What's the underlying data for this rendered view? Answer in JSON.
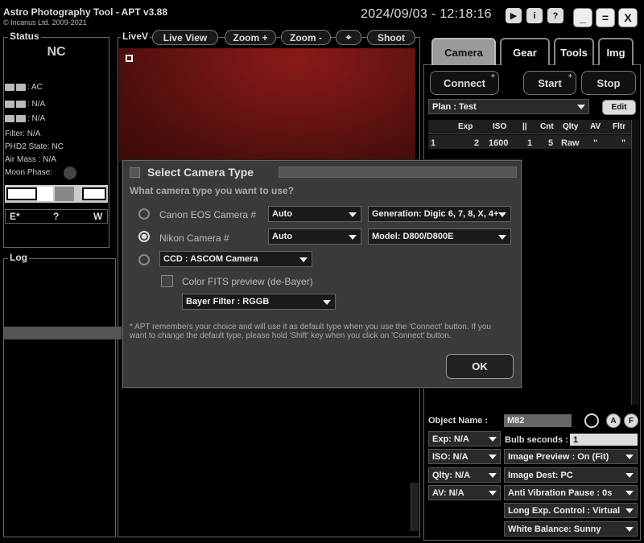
{
  "app": {
    "title": "Astro Photography Tool  -  APT v3.88",
    "copyright": "© Incanus Ltd. 2009-2021",
    "datetime": "2024/09/03 - 12:18:16"
  },
  "title_icons": {
    "play": "▶",
    "info": "i",
    "help": "?"
  },
  "window_buttons": {
    "minimize": "_",
    "maximize": "=",
    "close": "X"
  },
  "status": {
    "title": "Status",
    "connection": "NC",
    "power": ": AC",
    "camera_battery": ": N/A",
    "device_storage": ": N/A",
    "filter": "Filter: N/A",
    "phd2": "PHD2 State: NC",
    "air_mass": "Air Mass : N/A",
    "moon_phase": "Moon Phase:",
    "compass": {
      "e": "E*",
      "q": "?",
      "w": "W"
    }
  },
  "livev": {
    "title": "LiveV",
    "buttons": [
      "Live View",
      "Zoom +",
      "Zoom -",
      "⌖",
      "Shoot"
    ]
  },
  "log": {
    "title": "Log"
  },
  "tabs": [
    "Camera",
    "Gear",
    "Tools",
    "Img"
  ],
  "camera_panel": {
    "connect": "Connect",
    "start": "Start",
    "stop": "Stop",
    "plan": "Plan : Test",
    "edit": "Edit",
    "columns": [
      "Exp",
      "ISO",
      "||",
      "Cnt",
      "Qlty",
      "AV",
      "Fltr"
    ],
    "rows": [
      {
        "num": "1",
        "exp": "2",
        "iso": "1600",
        "pause": "1",
        "cnt": "5",
        "qlty": "Raw",
        "av": "\"",
        "fltr": "\""
      }
    ],
    "object_name_label": "Object Name :",
    "object_name": "M82",
    "btn_a": "A",
    "btn_f": "F",
    "exp": "Exp: N/A",
    "iso": "ISO: N/A",
    "qlty": "Qlty: N/A",
    "av": "AV: N/A",
    "bulb_label": "Bulb seconds :",
    "bulb_value": "1",
    "image_preview": "Image Preview : On (Fit)",
    "image_dest": "Image Dest: PC",
    "anti_vibration": "Anti Vibration Pause : 0s",
    "long_exp": "Long Exp. Control : Virtual",
    "white_balance": "White Balance: Sunny"
  },
  "dialog": {
    "title": "Select Camera Type",
    "question": "What camera type you want to use?",
    "canon_label": "Canon EOS Camera #",
    "canon_value": "Auto",
    "canon_gen": "Generation: Digic 6, 7, 8, X, 4+",
    "nikon_label": "Nikon Camera #",
    "nikon_value": "Auto",
    "nikon_model": "Model: D800/D800E",
    "ccd_value": "CCD : ASCOM Camera",
    "fits_label": "Color FITS preview (de-Bayer)",
    "bayer_value": "Bayer Filter : RGGB",
    "note": "* APT remembers your choice and will use it as default type when you use the 'Connect' button. If you want to change the default type, please hold 'Shift' key when you click on 'Connect' button.",
    "ok": "OK"
  }
}
